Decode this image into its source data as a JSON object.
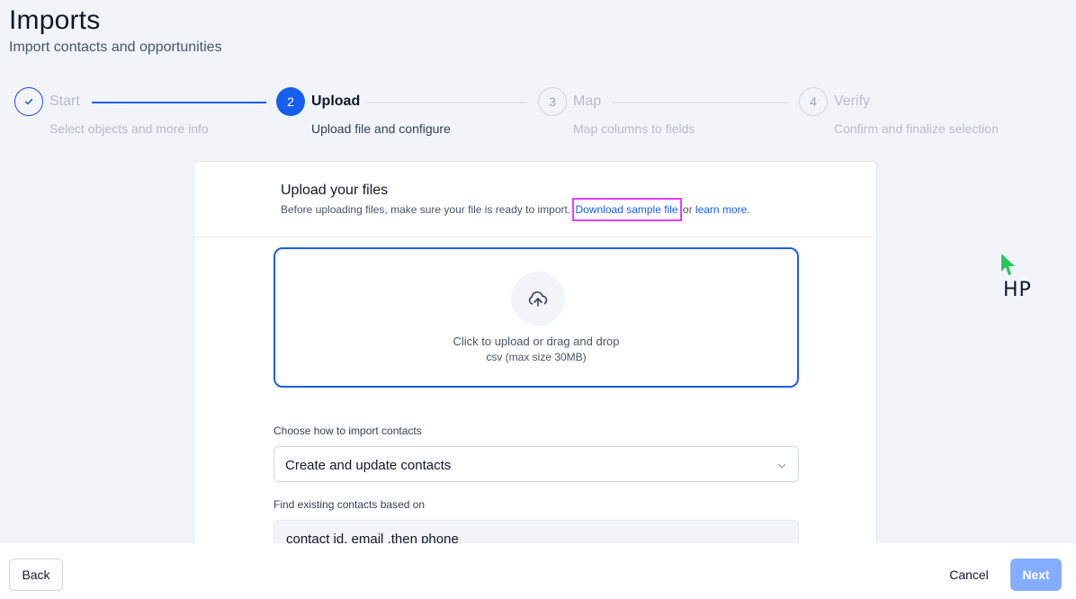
{
  "page": {
    "title": "Imports",
    "subtitle": "Import contacts and opportunities"
  },
  "stepper": {
    "steps": [
      {
        "number": "✓",
        "title": "Start",
        "description": "Select objects and more info",
        "state": "done"
      },
      {
        "number": "2",
        "title": "Upload",
        "description": "Upload file and configure",
        "state": "current"
      },
      {
        "number": "3",
        "title": "Map",
        "description": "Map columns to fields",
        "state": "future"
      },
      {
        "number": "4",
        "title": "Verify",
        "description": "Confirm and finalize selection",
        "state": "future"
      }
    ]
  },
  "upload": {
    "title": "Upload your files",
    "intro": "Before uploading files, make sure your file is ready to import.",
    "sample_link": "Download sample file",
    "or_text": "or",
    "learn_more": "learn more",
    "period": ".",
    "dropzone_line1": "Click to upload or drag and drop",
    "dropzone_line2": "csv (max size 30MB)",
    "dropzone_icon": "upload-cloud-icon"
  },
  "form": {
    "import_label": "Choose how to import contacts",
    "import_value": "Create and update contacts",
    "find_label": "Find existing contacts based on",
    "find_value": "contact id, email ,then phone"
  },
  "footer": {
    "back": "Back",
    "cancel": "Cancel",
    "next": "Next"
  },
  "overlay": {
    "cursor_tag": "HP",
    "cursor_color": "#22c55e",
    "highlight_color": "#e040fb"
  },
  "colors": {
    "accent": "#155eef",
    "next_disabled": "#84adff",
    "background": "#f1f5f9"
  }
}
